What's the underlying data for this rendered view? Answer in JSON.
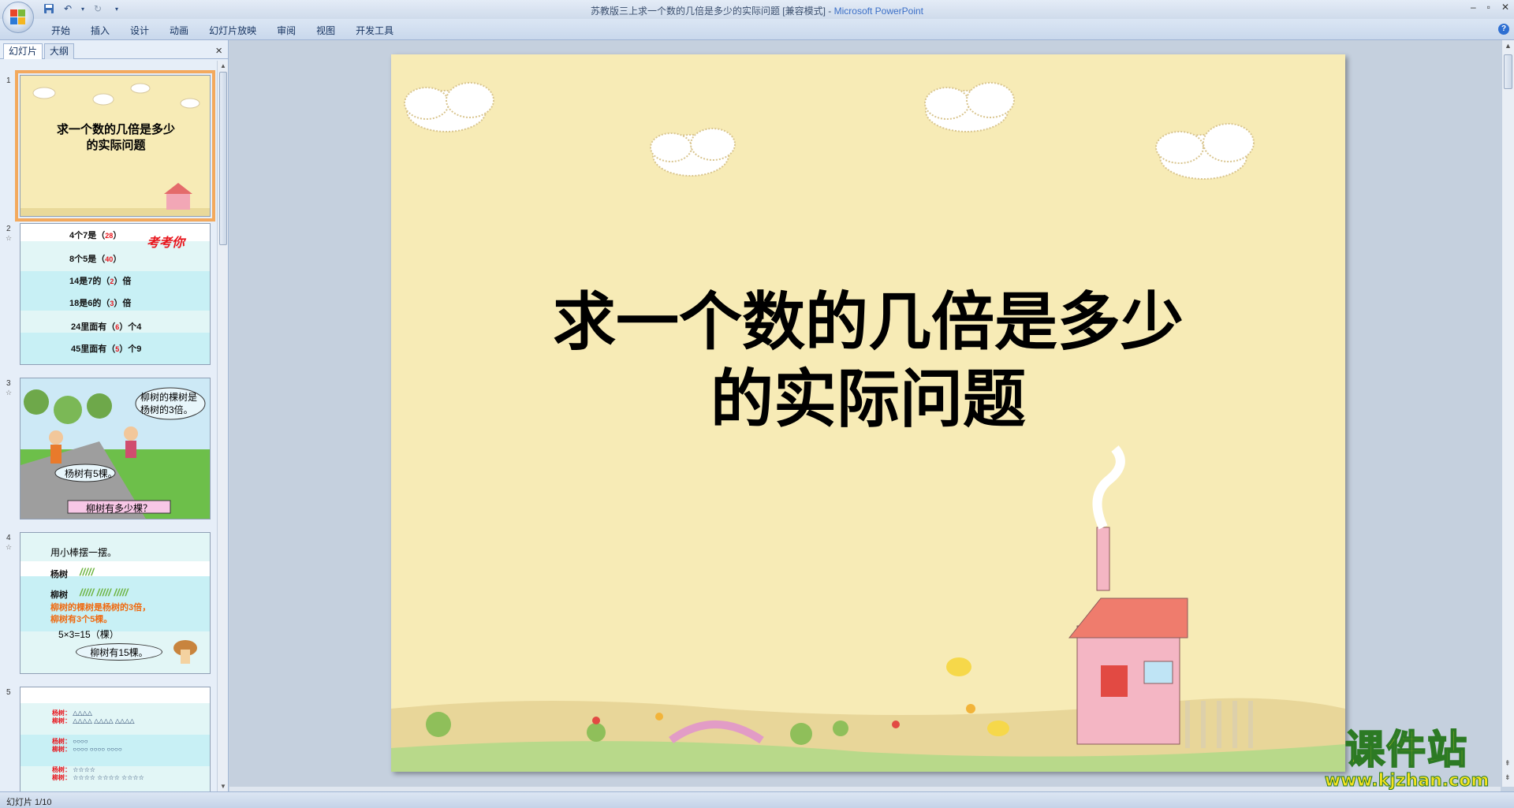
{
  "window": {
    "title": "苏教版三上求一个数的几倍是多少的实际问题 [兼容模式] - ",
    "app_name": "Microsoft PowerPoint"
  },
  "ribbon": {
    "tabs": [
      "开始",
      "插入",
      "设计",
      "动画",
      "幻灯片放映",
      "审阅",
      "视图",
      "开发工具"
    ]
  },
  "left_pane": {
    "tab_slides": "幻灯片",
    "tab_outline": "大纲",
    "close": "×"
  },
  "thumbnails": [
    {
      "number": "1",
      "title_line1": "求一个数的几倍是多少",
      "title_line2": "的实际问题"
    },
    {
      "number": "2",
      "heading": "考考你",
      "lines": [
        {
          "pre": "4个7是（",
          "ans": "28",
          "post": "）"
        },
        {
          "pre": "8个5是（",
          "ans": "40",
          "post": "）"
        },
        {
          "pre": "14是7的（",
          "ans": "2",
          "post": "）倍"
        },
        {
          "pre": "18是6的（",
          "ans": "3",
          "post": "）倍"
        },
        {
          "pre": "24里面有（",
          "ans": "6",
          "post": "）个4"
        },
        {
          "pre": "45里面有（",
          "ans": "5",
          "post": "）个9"
        }
      ]
    },
    {
      "number": "3",
      "bubble1": "柳树的棵树是杨树的3倍。",
      "bubble2": "杨树有5棵。",
      "question": "柳树有多少棵？"
    },
    {
      "number": "4",
      "line1": "用小棒摆一摆。",
      "label_a": "杨树",
      "sticks_a": "/////",
      "label_b": "柳树",
      "sticks_b": "/////  /////  /////",
      "orange1": "柳树的棵树是杨树的3倍，",
      "orange2": "柳树有3个5棵。",
      "calc": "5×3=15（棵）",
      "answer": "柳树有15棵。"
    },
    {
      "number": "5",
      "rows": [
        {
          "a": "杨树：",
          "ashapes": "△△△△",
          "b": "柳树：",
          "bshapes": "△△△△  △△△△  △△△△"
        },
        {
          "a": "杨树：",
          "ashapes": "○○○○",
          "b": "柳树：",
          "bshapes": "○○○○  ○○○○  ○○○○"
        },
        {
          "a": "杨树：",
          "ashapes": "☆☆☆☆",
          "b": "柳树：",
          "bshapes": "☆☆☆☆  ☆☆☆☆  ☆☆☆☆"
        }
      ]
    }
  ],
  "slide": {
    "title_line1": "求一个数的几倍是多少",
    "title_line2": "的实际问题"
  },
  "status": {
    "slide_indicator": "幻灯片 1/10"
  },
  "watermark": {
    "title": "课件站",
    "url": "www.kjzhan.com"
  },
  "colors": {
    "slide_bg": "#f7ebb6",
    "selection": "#f3a95d",
    "answer_red": "#e8141b",
    "orange_text": "#f0690f"
  }
}
